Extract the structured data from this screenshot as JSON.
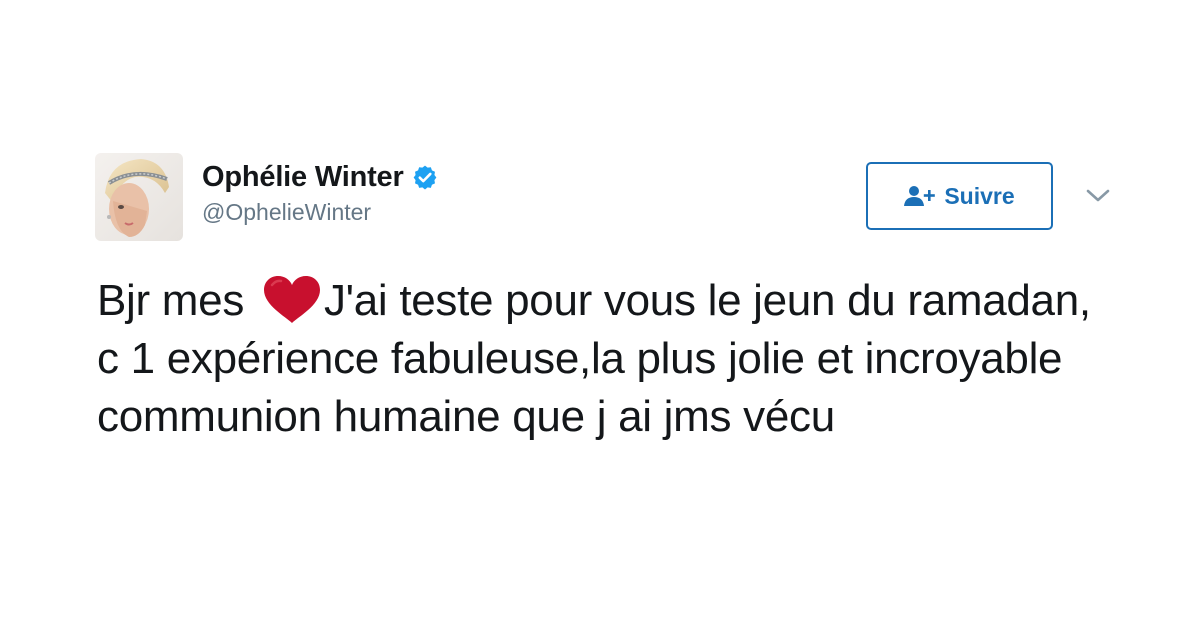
{
  "author": {
    "display_name": "Ophélie Winter",
    "handle": "@OphelieWinter",
    "verified_icon": "verified-badge-icon",
    "avatar": "avatar-photo"
  },
  "actions": {
    "follow_label": "Suivre",
    "follow_icon": "add-user-icon",
    "more_icon": "chevron-down-icon"
  },
  "tweet": {
    "text_before_emoji": "Bjr mes ",
    "emoji": "red-heart-icon",
    "text_after_emoji": "J'ai teste pour vous le jeun du ramadan, c 1 expérience fabuleuse,la plus jolie et incroyable communion humaine que j ai jms vécu"
  },
  "colors": {
    "brand_blue": "#1b6fb6",
    "verified_blue": "#1da1f2",
    "heart_red": "#c8102e",
    "text_primary": "#14171a",
    "text_secondary": "#657786"
  }
}
